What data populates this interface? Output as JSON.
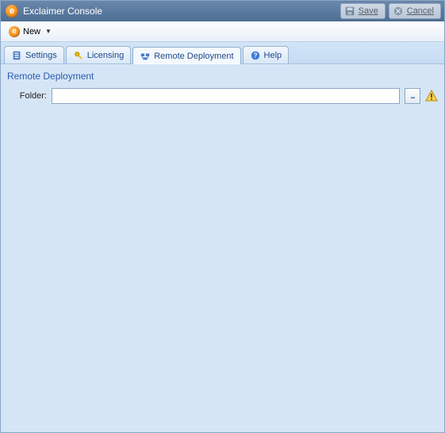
{
  "titlebar": {
    "app_title": "Exclaimer Console",
    "save_label": "Save",
    "cancel_label": "Cancel"
  },
  "toolbar": {
    "new_label": "New"
  },
  "tabs": {
    "settings": "Settings",
    "licensing": "Licensing",
    "remote_deployment": "Remote Deployment",
    "help": "Help"
  },
  "section": {
    "title": "Remote Deployment",
    "folder_label": "Folder:",
    "folder_value": "",
    "browse_label": "..."
  }
}
